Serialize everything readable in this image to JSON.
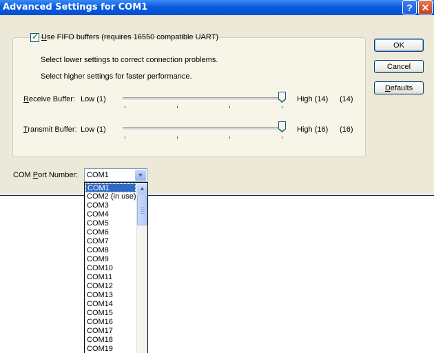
{
  "window": {
    "title": "Advanced Settings for COM1"
  },
  "fifo": {
    "label": "Use FIFO buffers (requires 16550 compatible UART)",
    "checked": true,
    "hint_lower": "Select lower settings to correct connection problems.",
    "hint_higher": "Select higher settings for faster performance."
  },
  "receive": {
    "label": "Receive Buffer:",
    "low": "Low (1)",
    "high": "High (14)",
    "value": "(14)",
    "level": 1.0
  },
  "transmit": {
    "label": "Transmit Buffer:",
    "low": "Low (1)",
    "high": "High (16)",
    "value": "(16)",
    "level": 1.0
  },
  "buttons": {
    "ok": "OK",
    "cancel": "Cancel",
    "defaults": "Defaults"
  },
  "com_port": {
    "label": "COM Port Number:",
    "selected": "COM1",
    "options": [
      "COM1",
      "COM2 (in use)",
      "COM3",
      "COM4",
      "COM5",
      "COM6",
      "COM7",
      "COM8",
      "COM9",
      "COM10",
      "COM11",
      "COM12",
      "COM13",
      "COM14",
      "COM15",
      "COM16",
      "COM17",
      "COM18",
      "COM19"
    ]
  },
  "colors": {
    "titlebar": "#0A5BE0",
    "selection": "#316AC5",
    "dialog_bg": "#ECE9D8"
  },
  "icons": {
    "help": "question-mark-icon",
    "close": "close-x-icon",
    "dropdown": "chevron-down-icon"
  }
}
